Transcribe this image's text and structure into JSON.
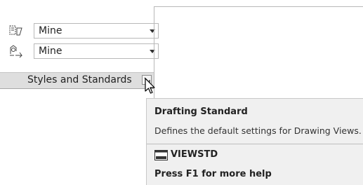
{
  "panel": {
    "combo_rows": [
      {
        "icon": "drawing-view-style-icon",
        "value": "Mine"
      },
      {
        "icon": "standard-style-icon",
        "value": "Mine"
      }
    ],
    "footer_title": "Styles and Standards",
    "launcher_icon": "dialog-launcher-icon"
  },
  "tooltip": {
    "title": "Drafting Standard",
    "description": "Defines the default settings for Drawing Views.",
    "command_icon": "command-line-icon",
    "command": "VIEWSTD",
    "help": "Press F1 for more help"
  },
  "cursor": "mouse-pointer-icon"
}
